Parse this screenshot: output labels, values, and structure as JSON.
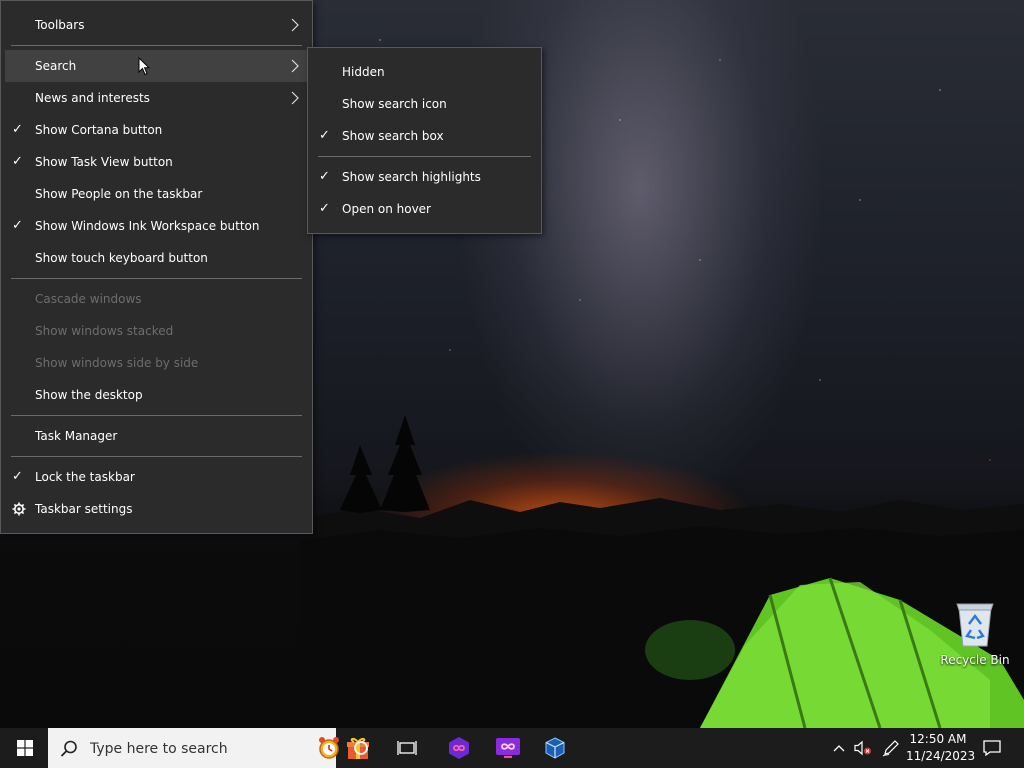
{
  "main_menu": {
    "items": [
      {
        "label": "Toolbars",
        "checked": false,
        "submenu": true
      },
      {
        "label": "Search",
        "checked": false,
        "submenu": true,
        "hover": true
      },
      {
        "label": "News and interests",
        "checked": false,
        "submenu": true
      },
      {
        "label": "Show Cortana button",
        "checked": true
      },
      {
        "label": "Show Task View button",
        "checked": true
      },
      {
        "label": "Show People on the taskbar",
        "checked": false
      },
      {
        "label": "Show Windows Ink Workspace button",
        "checked": true
      },
      {
        "label": "Show touch keyboard button",
        "checked": false
      },
      {
        "label": "Cascade windows",
        "disabled": true
      },
      {
        "label": "Show windows stacked",
        "disabled": true
      },
      {
        "label": "Show windows side by side",
        "disabled": true
      },
      {
        "label": "Show the desktop"
      },
      {
        "label": "Task Manager"
      },
      {
        "label": "Lock the taskbar",
        "checked": true
      },
      {
        "label": "Taskbar settings",
        "icon": "gear-icon"
      }
    ]
  },
  "search_submenu": {
    "items": [
      {
        "label": "Hidden",
        "checked": false
      },
      {
        "label": "Show search icon",
        "checked": false
      },
      {
        "label": "Show search box",
        "checked": true
      },
      {
        "label": "Show search highlights",
        "checked": true
      },
      {
        "label": "Open on hover",
        "checked": true
      }
    ]
  },
  "check_glyph": "✓",
  "desktop": {
    "recycle_bin_label": "Recycle Bin"
  },
  "taskbar": {
    "search_placeholder": "Type here to search",
    "clock_time": "12:50 AM",
    "clock_date": "11/24/2023",
    "icons": [
      "windows-start-icon",
      "search-icon",
      "cortana-icon",
      "task-view-icon",
      "app-infinity-icon",
      "app-infinity-pink-icon",
      "virtualbox-icon",
      "chevron-up-icon",
      "volume-muted-icon",
      "pen-workspace-icon",
      "notifications-icon"
    ]
  }
}
